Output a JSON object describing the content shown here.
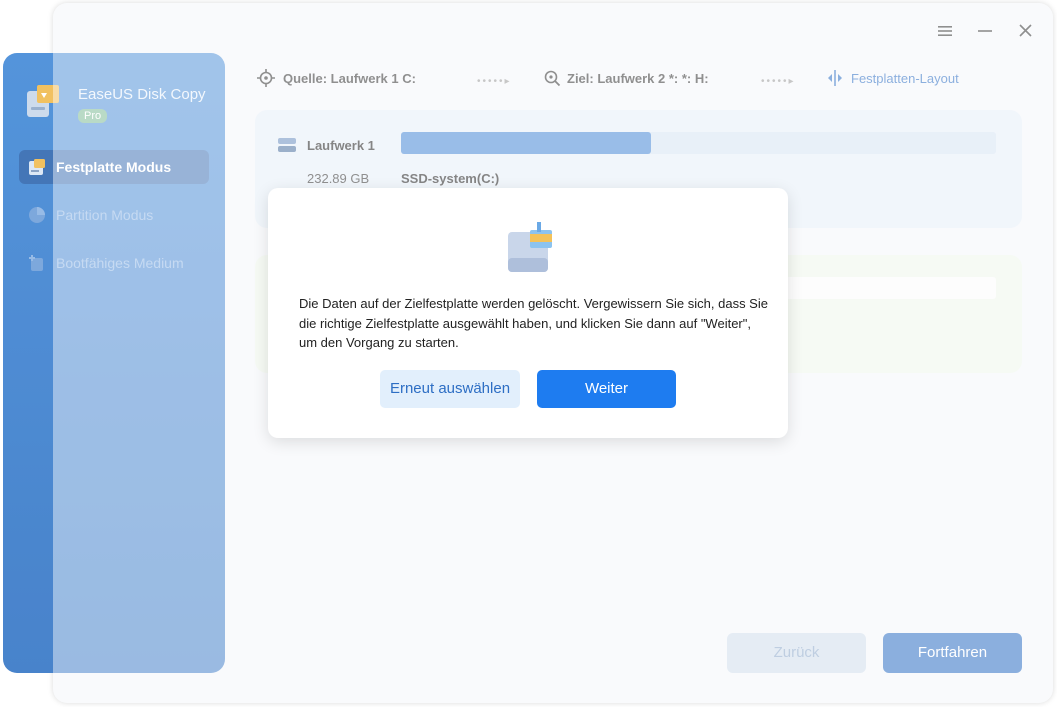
{
  "window": {
    "menu_icon": "hamburger-icon",
    "minimize_icon": "minimize-icon",
    "close_icon": "close-icon"
  },
  "sidebar": {
    "brand": "EaseUS Disk Copy",
    "badge": "Pro",
    "items": [
      {
        "label": "Festplatte Modus",
        "icon": "disk-icon",
        "active": true
      },
      {
        "label": "Partition Modus",
        "icon": "pie-icon",
        "active": false
      },
      {
        "label": "Bootfähiges Medium",
        "icon": "bootable-media-icon",
        "active": false
      }
    ]
  },
  "toolbar": {
    "source": "Quelle: Laufwerk 1 C:",
    "target": "Ziel: Laufwerk 2 *: *: H:",
    "layout": "Festplatten-Layout"
  },
  "disk": {
    "name": "Laufwerk 1",
    "size": "232.89 GB",
    "partition": "SSD-system(C:)",
    "used_fraction": 0.42
  },
  "footer": {
    "back_label": "Zurück",
    "continue_label": "Fortfahren"
  },
  "dialog": {
    "message": "Die Daten auf der Zielfestplatte werden gelöscht. Vergewissern Sie sich, dass Sie die richtige Zielfestplatte ausgewählt haben, und klicken Sie dann auf \"Weiter\", um den Vorgang zu starten.",
    "reselect_label": "Erneut auswählen",
    "next_label": "Weiter"
  },
  "colors": {
    "sidebar": "#3d86d6",
    "primary": "#1e7cf0",
    "accent_link": "#2d6ec4"
  }
}
